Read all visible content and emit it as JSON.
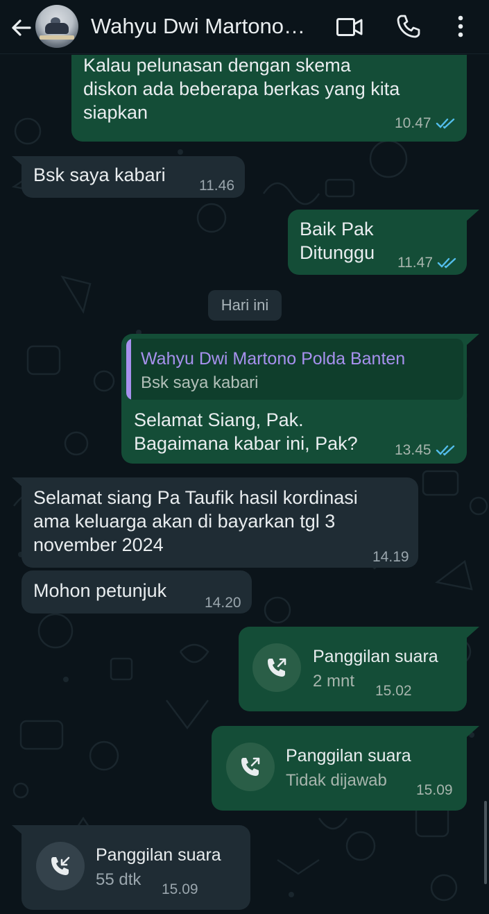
{
  "header": {
    "contact_name": "Wahyu Dwi Martono…",
    "icons": [
      "back-arrow-icon",
      "video-call-icon",
      "voice-call-icon",
      "more-vertical-icon"
    ]
  },
  "messages": {
    "m1": {
      "text_lines": [
        "Kalau pelunasan dengan skema",
        "diskon ada beberapa berkas yang kita",
        "siapkan"
      ],
      "line1": "Kalau pelunasan dengan skema",
      "line2": "diskon ada beberapa berkas yang kita",
      "line3": "siapkan",
      "time": "10.47",
      "status": "read"
    },
    "m2": {
      "text": "Bsk saya kabari",
      "time": "11.46"
    },
    "m3": {
      "line1": "Baik Pak",
      "line2": "Ditunggu",
      "time": "11.47",
      "status": "read"
    },
    "day_divider": "Hari ini",
    "m4": {
      "quote_name": "Wahyu Dwi Martono Polda Banten",
      "quote_text": "Bsk saya kabari",
      "line1": "Selamat Siang, Pak.",
      "line2": "Bagaimana kabar ini, Pak?",
      "time": "13.45",
      "status": "read"
    },
    "m5": {
      "line1": "Selamat siang Pa Taufik hasil kordinasi",
      "line2": "ama keluarga akan di bayarkan tgl 3",
      "line3": "november 2024",
      "time": "14.19"
    },
    "m6": {
      "text": "Mohon petunjuk",
      "time": "14.20"
    },
    "c1": {
      "title": "Panggilan suara",
      "sub": "2 mnt",
      "time": "15.02",
      "direction": "outgoing"
    },
    "c2": {
      "title": "Panggilan suara",
      "sub": "Tidak dijawab",
      "time": "15.09",
      "direction": "outgoing"
    },
    "c3": {
      "title": "Panggilan suara",
      "sub": "55 dtk",
      "time": "15.09",
      "direction": "incoming"
    }
  },
  "colors": {
    "background": "#0b141a",
    "outgoing_bubble": "#144d37",
    "incoming_bubble": "#1f2c34",
    "read_ticks": "#53bdeb",
    "quote_accent": "#a791ee"
  }
}
